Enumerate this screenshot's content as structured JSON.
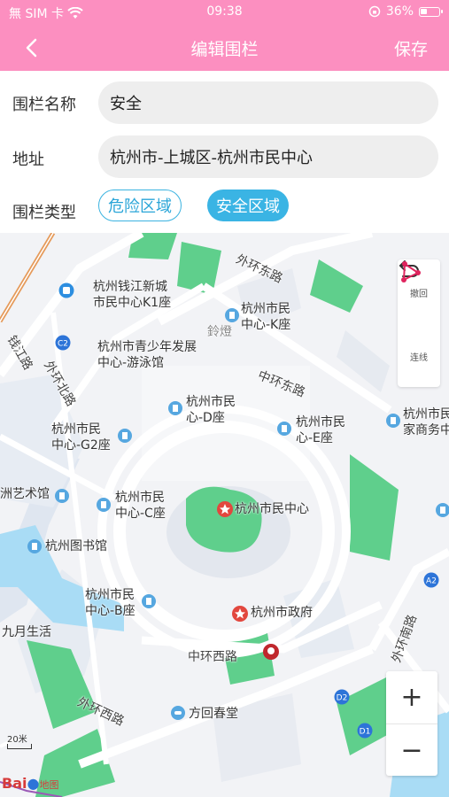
{
  "status_bar": {
    "carrier": "無 SIM 卡",
    "time": "09:38",
    "battery_percent": "36%",
    "battery_level": 0.36
  },
  "nav": {
    "title": "编辑围栏",
    "save_label": "保存"
  },
  "form": {
    "name_label": "围栏名称",
    "name_value": "安全",
    "address_label": "地址",
    "address_value": "杭州市-上城区-杭州市民中心",
    "type_label": "围栏类型",
    "type_options": [
      "危险区域",
      "安全区域"
    ],
    "type_selected": "安全区域"
  },
  "map": {
    "pois": {
      "k1": "杭州钱江新城\n市民中心K1座",
      "k": "杭州市民\n中心-K座",
      "youth": "杭州市青少年发展\n中心-游泳馆",
      "d": "杭州市民\n心-D座",
      "g2": "杭州市民\n中心-G2座",
      "e": "杭州市民\n心-E座",
      "biz": "杭州市民\n家商务中",
      "art": "洲艺术馆",
      "c": "杭州市民\n中心-C座",
      "center": "杭州市民中心",
      "library": "杭州图书馆",
      "b": "杭州市民\n中心-B座",
      "gov": "杭州市政府",
      "sept": "九月生活",
      "fanghui": "方回春堂",
      "lingdeng": "鈴燈"
    },
    "roads": {
      "outer_east": "外环东路",
      "middle_east": "中环东路",
      "middle_west": "中环西路",
      "outer_west": "外环西路",
      "outer_south": "外环南路",
      "outer_north": "外环北路",
      "qianjiang": "钱江路"
    },
    "badges": [
      "C2",
      "A2",
      "D2",
      "D1"
    ],
    "tools": {
      "undo_label": "撤回",
      "connect_label": "连线"
    },
    "zoom_in": "+",
    "zoom_out": "−",
    "scale_label": "20米",
    "logo_text": "Bai",
    "logo_map_word": "地图"
  },
  "colors": {
    "header": "#fc8fc0",
    "accent": "#3ab4e4",
    "map_green": "#5fcf8c",
    "map_water": "#a9dcf5"
  }
}
